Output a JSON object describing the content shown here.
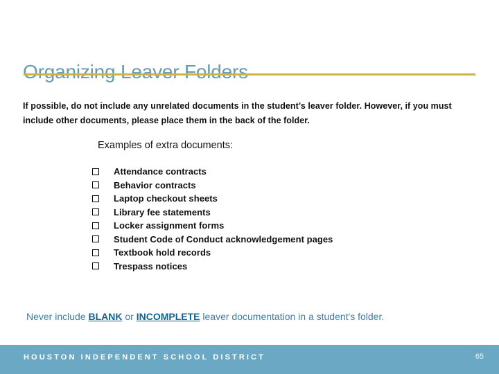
{
  "slide": {
    "title": "Organizing Leaver Folders",
    "body": "If possible, do not include any unrelated documents in the student’s leaver folder. However, if you must include other documents, please place them in the back of the folder.",
    "examples_heading": "Examples of extra documents:",
    "documents": [
      {
        "checkbox_icon": "empty-checkbox-icon",
        "label": "Attendance contracts"
      },
      {
        "checkbox_icon": "empty-checkbox-icon",
        "label": "Behavior contracts"
      },
      {
        "checkbox_icon": "empty-checkbox-icon",
        "label": "Laptop checkout sheets"
      },
      {
        "checkbox_icon": "empty-checkbox-icon",
        "label": "Library fee statements"
      },
      {
        "checkbox_icon": "empty-checkbox-icon",
        "label": "Locker assignment forms"
      },
      {
        "checkbox_icon": "empty-checkbox-icon",
        "label": "Student Code of Conduct acknowledgement pages"
      },
      {
        "checkbox_icon": "empty-checkbox-icon",
        "label": "Textbook hold records"
      },
      {
        "checkbox_icon": "empty-checkbox-icon",
        "label": "Trespass notices"
      }
    ],
    "closing_note": {
      "lead": "Never include ",
      "emphasis_1": "BLANK",
      "conjunction": " or ",
      "emphasis_2": "INCOMPLETE",
      "tail": " leaver documentation in a student's folder."
    }
  },
  "footer": {
    "organization": "HOUSTON INDEPENDENT SCHOOL DISTRICT",
    "page_number": "65"
  },
  "colors": {
    "title": "#689bb0",
    "rule": "#ceb34a",
    "footer_bar": "#6aa8c4",
    "note": "#3b7ea3",
    "note_emphasis": "#14628e"
  }
}
